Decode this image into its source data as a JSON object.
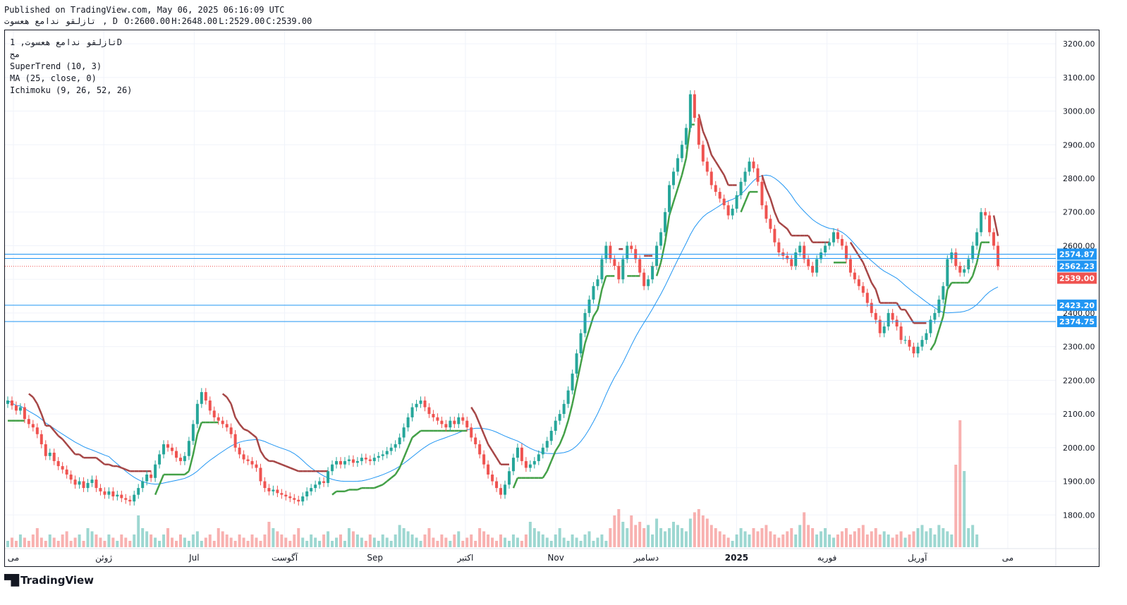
{
  "header": {
    "published": "Published on TradingView.com, May 06, 2025 06:16:09 UTC",
    "symbol": "تازلقو ندامع هعسوت",
    "interval": "D",
    "ohlc": [
      "O:2600.00",
      "H:2648.00",
      "L:2529.00",
      "C:2539.00"
    ]
  },
  "legend": {
    "title": "تازلقو ندامع هعسوت, 1D",
    "subtitle": "مج",
    "indicators": [
      "SuperTrend (10, 3)",
      "MA (25, close, 0)",
      "Ichimoku (9, 26, 52, 26)"
    ]
  },
  "footer": {
    "brand": "TradingView",
    "brand_icon": "tradingview-logo-icon"
  },
  "colors": {
    "up": "#26a69a",
    "down": "#ef5350",
    "supertrend_up": "#43a047",
    "supertrend_down": "#a64646",
    "ma": "#2196f3",
    "hline": "#2196f3"
  },
  "chart_data": {
    "type": "candlestick",
    "y_axis": {
      "ticks": [
        1800,
        1900,
        2000,
        2100,
        2200,
        2300,
        2400,
        2500,
        2600,
        2700,
        2800,
        2900,
        3000,
        3100,
        3200
      ],
      "range": [
        1700,
        3240
      ],
      "side": "right"
    },
    "x_axis": {
      "labels": [
        "می",
        "ژوئن",
        "Jul",
        "آگوست",
        "Sep",
        "اکتبر",
        "Nov",
        "دسامبر",
        "2025",
        "فوریه",
        "آوریل",
        "می"
      ]
    },
    "horizontal_lines": [
      2574.87,
      2562.23,
      2423.2,
      2374.75
    ],
    "price_labels": [
      {
        "text": "2574.87",
        "value": 2574.87,
        "color": "#2196f3"
      },
      {
        "text": "2562.23",
        "value": 2562.23,
        "color": "#2196f3"
      },
      {
        "text": "2539.00",
        "value": 2539.0,
        "color": "#ef5350"
      },
      {
        "text": "2423.20",
        "value": 2423.2,
        "color": "#2196f3"
      },
      {
        "text": "2374.75",
        "value": 2374.75,
        "color": "#2196f3"
      }
    ],
    "last_close": 2539.0,
    "candles_close": [
      2140,
      2125,
      2110,
      2120,
      2085,
      2070,
      2060,
      2040,
      2010,
      1975,
      1985,
      1960,
      1945,
      1935,
      1920,
      1905,
      1890,
      1900,
      1880,
      1895,
      1905,
      1880,
      1870,
      1860,
      1870,
      1855,
      1860,
      1850,
      1845,
      1840,
      1860,
      1880,
      1900,
      1920,
      1910,
      1950,
      1980,
      2010,
      2000,
      1990,
      1970,
      1960,
      1975,
      2020,
      2070,
      2130,
      2165,
      2140,
      2110,
      2090,
      2080,
      2070,
      2060,
      2040,
      2000,
      1980,
      1965,
      1960,
      1950,
      1940,
      1900,
      1880,
      1870,
      1875,
      1865,
      1860,
      1855,
      1850,
      1845,
      1840,
      1855,
      1870,
      1880,
      1890,
      1900,
      1895,
      1930,
      1950,
      1960,
      1950,
      1960,
      1965,
      1955,
      1960,
      1970,
      1965,
      1960,
      1970,
      1975,
      1980,
      1990,
      2000,
      2010,
      2030,
      2060,
      2090,
      2120,
      2130,
      2140,
      2120,
      2100,
      2090,
      2080,
      2070,
      2060,
      2080,
      2070,
      2090,
      2080,
      2060,
      2030,
      2010,
      1980,
      1950,
      1920,
      1900,
      1880,
      1860,
      1890,
      1930,
      1970,
      2000,
      1960,
      1940,
      1950,
      1960,
      1980,
      2000,
      2020,
      2050,
      2080,
      2100,
      2130,
      2170,
      2220,
      2280,
      2340,
      2400,
      2440,
      2480,
      2500,
      2560,
      2600,
      2560,
      2540,
      2500,
      2560,
      2600,
      2590,
      2560,
      2520,
      2480,
      2500,
      2540,
      2600,
      2640,
      2700,
      2780,
      2820,
      2860,
      2900,
      2950,
      3050,
      2980,
      2900,
      2850,
      2820,
      2780,
      2760,
      2740,
      2720,
      2690,
      2710,
      2750,
      2790,
      2820,
      2850,
      2830,
      2790,
      2720,
      2680,
      2650,
      2610,
      2580,
      2570,
      2560,
      2540,
      2580,
      2600,
      2560,
      2540,
      2520,
      2560,
      2580,
      2600,
      2610,
      2640,
      2620,
      2600,
      2560,
      2520,
      2500,
      2480,
      2460,
      2430,
      2400,
      2380,
      2340,
      2360,
      2400,
      2380,
      2360,
      2320,
      2320,
      2300,
      2280,
      2300,
      2320,
      2340,
      2380,
      2400,
      2440,
      2480,
      2560,
      2580,
      2540,
      2520,
      2530,
      2560,
      2600,
      2640,
      2700,
      2690,
      2640,
      2600,
      2539
    ],
    "volume_relative": [
      0.1,
      0.15,
      0.1,
      0.2,
      0.15,
      0.1,
      0.2,
      0.3,
      0.15,
      0.1,
      0.2,
      0.15,
      0.1,
      0.2,
      0.25,
      0.1,
      0.15,
      0.2,
      0.1,
      0.3,
      0.25,
      0.2,
      0.15,
      0.1,
      0.2,
      0.15,
      0.1,
      0.2,
      0.15,
      0.1,
      0.2,
      0.5,
      0.3,
      0.25,
      0.2,
      0.15,
      0.1,
      0.2,
      0.3,
      0.15,
      0.1,
      0.2,
      0.15,
      0.1,
      0.2,
      0.25,
      0.1,
      0.15,
      0.2,
      0.1,
      0.3,
      0.25,
      0.2,
      0.15,
      0.1,
      0.2,
      0.15,
      0.1,
      0.2,
      0.15,
      0.1,
      0.2,
      0.4,
      0.3,
      0.25,
      0.2,
      0.15,
      0.1,
      0.2,
      0.3,
      0.15,
      0.1,
      0.2,
      0.15,
      0.1,
      0.2,
      0.25,
      0.1,
      0.15,
      0.2,
      0.1,
      0.3,
      0.25,
      0.2,
      0.15,
      0.1,
      0.2,
      0.15,
      0.1,
      0.2,
      0.15,
      0.1,
      0.2,
      0.35,
      0.3,
      0.25,
      0.2,
      0.15,
      0.1,
      0.2,
      0.3,
      0.15,
      0.1,
      0.2,
      0.15,
      0.1,
      0.2,
      0.25,
      0.1,
      0.15,
      0.2,
      0.1,
      0.3,
      0.25,
      0.2,
      0.15,
      0.1,
      0.2,
      0.15,
      0.1,
      0.2,
      0.15,
      0.1,
      0.2,
      0.4,
      0.3,
      0.25,
      0.2,
      0.15,
      0.1,
      0.2,
      0.3,
      0.15,
      0.1,
      0.2,
      0.15,
      0.1,
      0.2,
      0.25,
      0.1,
      0.15,
      0.2,
      0.1,
      0.3,
      0.5,
      0.6,
      0.4,
      0.3,
      0.5,
      0.35,
      0.4,
      0.3,
      0.35,
      0.2,
      0.45,
      0.3,
      0.25,
      0.3,
      0.4,
      0.35,
      0.3,
      0.25,
      0.45,
      0.55,
      0.6,
      0.5,
      0.45,
      0.35,
      0.3,
      0.25,
      0.2,
      0.15,
      0.1,
      0.2,
      0.3,
      0.25,
      0.2,
      0.3,
      0.25,
      0.3,
      0.35,
      0.25,
      0.2,
      0.15,
      0.2,
      0.25,
      0.3,
      0.2,
      0.35,
      0.55,
      0.35,
      0.3,
      0.2,
      0.25,
      0.3,
      0.2,
      0.15,
      0.2,
      0.25,
      0.3,
      0.2,
      0.25,
      0.3,
      0.35,
      0.2,
      0.25,
      0.3,
      0.2,
      0.25,
      0.2,
      0.15,
      0.2,
      0.25,
      0.15,
      0.2,
      0.25,
      0.3,
      0.35,
      0.25,
      0.3,
      0.2,
      0.35,
      0.3,
      0.25,
      0.2,
      1.3,
      2.0,
      1.2,
      0.3,
      0.35,
      0.2
    ]
  }
}
